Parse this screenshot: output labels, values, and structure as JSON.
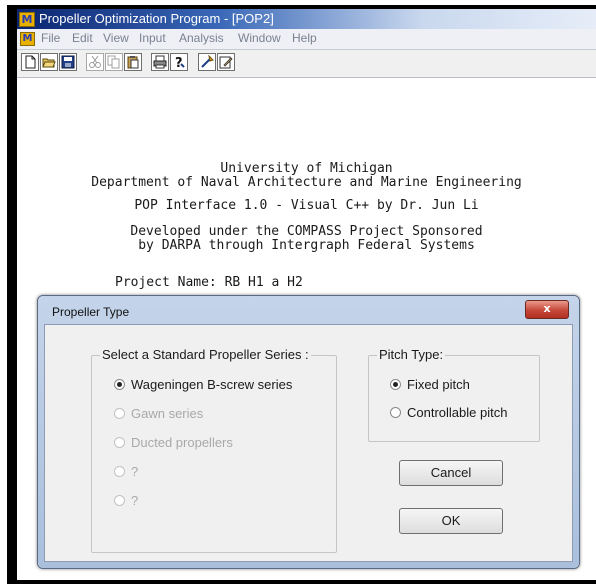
{
  "window": {
    "title": "Propeller Optimization Program - [POP2]",
    "app_icon": "M"
  },
  "menu": {
    "doc_icon": "M",
    "items": [
      "File",
      "Edit",
      "View",
      "Input",
      "Analysis",
      "Window",
      "Help"
    ]
  },
  "toolbar": {
    "icons": [
      "new-file-icon",
      "open-folder-icon",
      "save-icon",
      "cut-icon",
      "copy-icon",
      "paste-icon",
      "print-icon",
      "help-icon",
      "wizard-icon",
      "edit-icon"
    ]
  },
  "document": {
    "line1": "University of Michigan",
    "line2": "Department of Naval Architecture and Marine Engineering",
    "line3": "POP Interface 1.0 - Visual C++ by Dr. Jun Li",
    "line4": "Developed under the COMPASS Project Sponsored",
    "line5": "by DARPA through Intergraph Federal Systems",
    "project": "Project Name: RB H1 a H2"
  },
  "dialog": {
    "title": "Propeller Type",
    "close_glyph": "x",
    "series_group": {
      "label": "Select a Standard Propeller Series :",
      "options": [
        {
          "label": "Wageningen B-screw series",
          "selected": true,
          "enabled": true
        },
        {
          "label": "Gawn series",
          "selected": false,
          "enabled": false
        },
        {
          "label": "Ducted propellers",
          "selected": false,
          "enabled": false
        },
        {
          "label": "?",
          "selected": false,
          "enabled": false
        },
        {
          "label": "?",
          "selected": false,
          "enabled": false
        }
      ]
    },
    "pitch_group": {
      "label": "Pitch Type:",
      "options": [
        {
          "label": "Fixed pitch",
          "selected": true,
          "enabled": true
        },
        {
          "label": "Controllable pitch",
          "selected": false,
          "enabled": true
        }
      ]
    },
    "cancel_label": "Cancel",
    "ok_label": "OK"
  }
}
